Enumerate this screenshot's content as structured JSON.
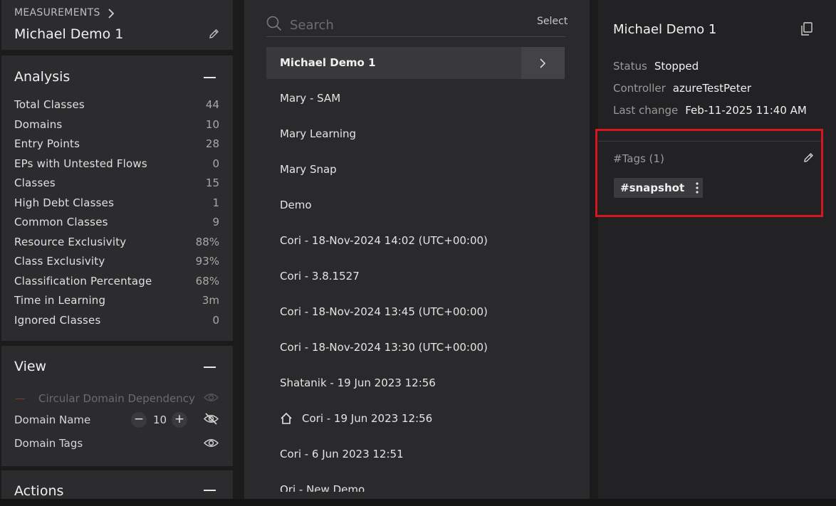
{
  "measurements": {
    "header_label": "MEASUREMENTS",
    "name": "Michael Demo 1"
  },
  "analysis": {
    "title": "Analysis",
    "stats": [
      {
        "label": "Total Classes",
        "value": "44"
      },
      {
        "label": "Domains",
        "value": "10"
      },
      {
        "label": "Entry Points",
        "value": "28"
      },
      {
        "label": "EPs with Untested Flows",
        "value": "0"
      },
      {
        "label": "Classes",
        "value": "15"
      },
      {
        "label": "High Debt Classes",
        "value": "1"
      },
      {
        "label": "Common Classes",
        "value": "9"
      },
      {
        "label": "Resource Exclusivity",
        "value": "88%"
      },
      {
        "label": "Class Exclusivity",
        "value": "93%"
      },
      {
        "label": "Classification Percentage",
        "value": "68%"
      },
      {
        "label": "Time in Learning",
        "value": "3m"
      },
      {
        "label": "Ignored Classes",
        "value": "0"
      }
    ]
  },
  "view": {
    "title": "View",
    "circular_label": "Circular Domain Dependency",
    "domain_name_label": "Domain Name",
    "domain_name_value": "10",
    "domain_tags_label": "Domain Tags"
  },
  "actions": {
    "title": "Actions"
  },
  "list_panel": {
    "search_placeholder": "Search",
    "select_label": "Select",
    "items": [
      {
        "label": "Michael Demo 1",
        "selected": true
      },
      {
        "label": "Mary - SAM"
      },
      {
        "label": "Mary Learning"
      },
      {
        "label": "Mary Snap"
      },
      {
        "label": "Demo"
      },
      {
        "label": "Cori - 18-Nov-2024 14:02 (UTC+00:00)"
      },
      {
        "label": "Cori - 3.8.1527"
      },
      {
        "label": "Cori - 18-Nov-2024 13:45 (UTC+00:00)"
      },
      {
        "label": "Cori - 18-Nov-2024 13:30 (UTC+00:00)"
      },
      {
        "label": "Shatanik - 19 Jun 2023 12:56"
      },
      {
        "label": "Cori - 19 Jun 2023 12:56",
        "icon": "home-icon"
      },
      {
        "label": "Cori - 6 Jun 2023 12:51"
      },
      {
        "label": "Ori - New Demo"
      }
    ]
  },
  "details": {
    "title": "Michael Demo 1",
    "status_key": "Status",
    "status_value": "Stopped",
    "controller_key": "Controller",
    "controller_value": "azureTestPeter",
    "last_change_key": "Last change",
    "last_change_value": "Feb-11-2025 11:40 AM",
    "tags_title": "#Tags (1)",
    "tags": [
      "#snapshot"
    ]
  },
  "colors": {
    "highlight": "#d6171d",
    "circular_dash": "#8a3a2a"
  }
}
